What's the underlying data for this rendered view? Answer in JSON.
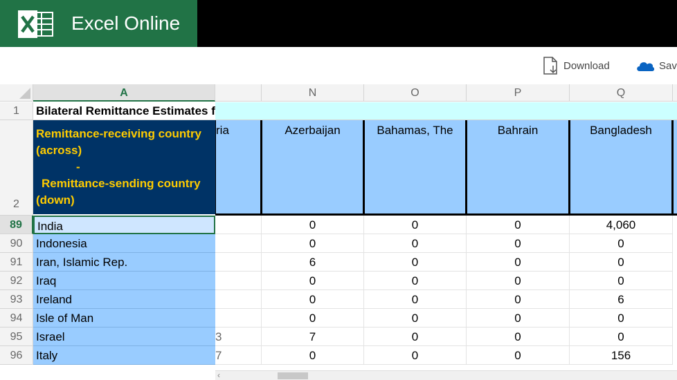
{
  "app": {
    "title": "Excel Online"
  },
  "toolbar": {
    "download_label": "Download",
    "save_label": "Save"
  },
  "columns": [
    "A",
    "N",
    "O",
    "P",
    "Q"
  ],
  "row1": {
    "number": "1",
    "a_text": "Bilateral Remittance Estimates f"
  },
  "row2": {
    "number": "2",
    "a_lines": [
      "Remittance-receiving country",
      "(across)",
      "-",
      "Remittance-sending country",
      "(down)"
    ],
    "partial_header": "ria",
    "headers": [
      "Azerbaijan",
      "Bahamas, The",
      "Bahrain",
      "Bangladesh"
    ]
  },
  "rows": [
    {
      "num": "89",
      "name": "India",
      "selected": true,
      "partial": "",
      "values": [
        "0",
        "0",
        "0",
        "4,060"
      ]
    },
    {
      "num": "90",
      "name": "Indonesia",
      "partial": "",
      "values": [
        "0",
        "0",
        "0",
        "0"
      ]
    },
    {
      "num": "91",
      "name": "Iran, Islamic Rep.",
      "partial": "",
      "values": [
        "6",
        "0",
        "0",
        "0"
      ]
    },
    {
      "num": "92",
      "name": "Iraq",
      "partial": "",
      "values": [
        "0",
        "0",
        "0",
        "0"
      ]
    },
    {
      "num": "93",
      "name": "Ireland",
      "partial": "",
      "values": [
        "0",
        "0",
        "0",
        "6"
      ]
    },
    {
      "num": "94",
      "name": "Isle of Man",
      "partial": "",
      "values": [
        "0",
        "0",
        "0",
        "0"
      ]
    },
    {
      "num": "95",
      "name": "Israel",
      "partial": "3",
      "values": [
        "7",
        "0",
        "0",
        "0"
      ]
    },
    {
      "num": "96",
      "name": "Italy",
      "partial": "7",
      "values": [
        "0",
        "0",
        "0",
        "156"
      ]
    }
  ],
  "colors": {
    "brand": "#217346",
    "header_fill": "#99ccff",
    "title_fill": "#003366",
    "title_text": "#ffcc00",
    "row1_fill": "#ccffff"
  },
  "icons": {
    "logo": "excel-logo-icon",
    "download": "download-icon",
    "save": "onedrive-cloud-icon"
  }
}
